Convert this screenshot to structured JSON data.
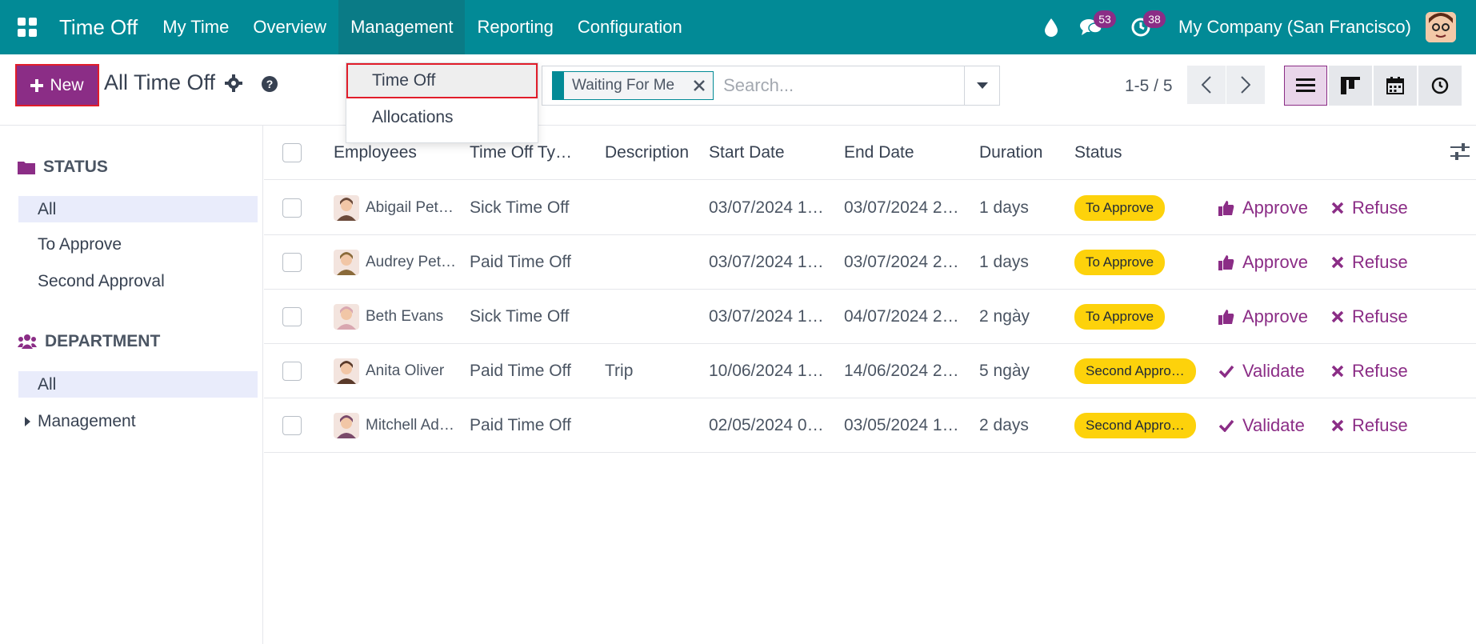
{
  "navbar": {
    "apps_icon": "grid-icon",
    "brand": "Time Off",
    "menu": [
      "My Time",
      "Overview",
      "Management",
      "Reporting",
      "Configuration"
    ],
    "icons": {
      "drop": "water-drop-icon",
      "chat": "chat-icon",
      "activity": "clock-icon"
    },
    "chat_count": "53",
    "activity_count": "38",
    "company": "My Company (San Francisco)"
  },
  "control": {
    "new_label": "New",
    "title": "All Time Off",
    "facet": "Waiting For Me",
    "search_placeholder": "Search...",
    "pager": "1-5 / 5"
  },
  "dropdown": {
    "items": [
      "Time Off",
      "Allocations"
    ]
  },
  "sidebar": {
    "status_header": "STATUS",
    "status_items": [
      "All",
      "To Approve",
      "Second Approval"
    ],
    "department_header": "DEPARTMENT",
    "department_items": [
      "All",
      "Management"
    ]
  },
  "table": {
    "columns": [
      "Employees",
      "Time Off Ty…",
      "Description",
      "Start Date",
      "End Date",
      "Duration",
      "Status"
    ],
    "rows": [
      {
        "employee": "Abigail Pet…",
        "type": "Sick Time Off",
        "description": "",
        "start": "03/07/2024 1…",
        "end": "03/07/2024 2…",
        "duration": "1 days",
        "status": "To Approve",
        "action": "Approve",
        "refuse": "Refuse",
        "avatar_color": "#6b4a3a"
      },
      {
        "employee": "Audrey Pet…",
        "type": "Paid Time Off",
        "description": "",
        "start": "03/07/2024 1…",
        "end": "03/07/2024 2…",
        "duration": "1 days",
        "status": "To Approve",
        "action": "Approve",
        "refuse": "Refuse",
        "avatar_color": "#8a6a3a"
      },
      {
        "employee": "Beth Evans",
        "type": "Sick Time Off",
        "description": "",
        "start": "03/07/2024 1…",
        "end": "04/07/2024 2…",
        "duration": "2 ngày",
        "status": "To Approve",
        "action": "Approve",
        "refuse": "Refuse",
        "avatar_color": "#d9a7b0"
      },
      {
        "employee": "Anita Oliver",
        "type": "Paid Time Off",
        "description": "Trip",
        "start": "10/06/2024 1…",
        "end": "14/06/2024 2…",
        "duration": "5 ngày",
        "status": "Second Appro…",
        "action": "Validate",
        "refuse": "Refuse",
        "avatar_color": "#5a3a2a"
      },
      {
        "employee": "Mitchell Ad…",
        "type": "Paid Time Off",
        "description": "",
        "start": "02/05/2024 0…",
        "end": "03/05/2024 1…",
        "duration": "2 days",
        "status": "Second Appro…",
        "action": "Validate",
        "refuse": "Refuse",
        "avatar_color": "#7a4a6a"
      }
    ]
  },
  "colors": {
    "navbar": "#028a96",
    "primary": "#8b2d86",
    "status_pill": "#fdd20b",
    "highlight_border": "#e11d2a"
  }
}
